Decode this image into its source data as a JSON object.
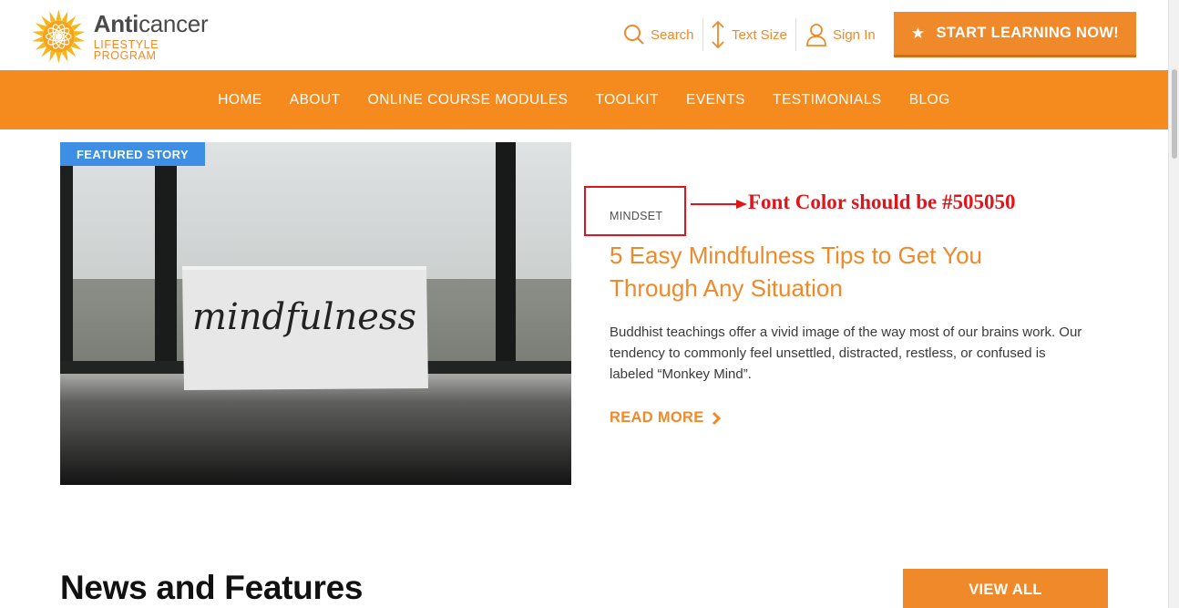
{
  "header": {
    "logo": {
      "title_bold": "Anti",
      "title_rest": "cancer",
      "subtitle": "LIFESTYLE PROGRAM"
    },
    "search_label": "Search",
    "text_size_label": "Text Size",
    "sign_in_label": "Sign In",
    "cta_label": "START LEARNING NOW!"
  },
  "nav": {
    "items": [
      "HOME",
      "ABOUT",
      "ONLINE COURSE MODULES",
      "TOOLKIT",
      "EVENTS",
      "TESTIMONIALS",
      "BLOG"
    ]
  },
  "featured": {
    "badge": "FEATURED STORY",
    "image_card_text": "mindfulness",
    "category": "MINDSET",
    "title": "5 Easy Mindfulness Tips to Get You Through Any Situation",
    "excerpt": "Buddhist teachings offer a vivid image of the way most of our brains work. Our tendency to commonly feel unsettled, distracted, restless, or confused is labeled “Monkey Mind”.",
    "read_more": "READ MORE"
  },
  "annotation": {
    "text": "Font Color should be #505050",
    "color": "#e0141a"
  },
  "news": {
    "title": "News and Features",
    "view_all": "VIEW ALL"
  },
  "colors": {
    "brand_orange": "#f0892a",
    "nav_orange": "#f58a1f",
    "badge_blue": "#3d8ee4",
    "category_text": "#505050"
  }
}
